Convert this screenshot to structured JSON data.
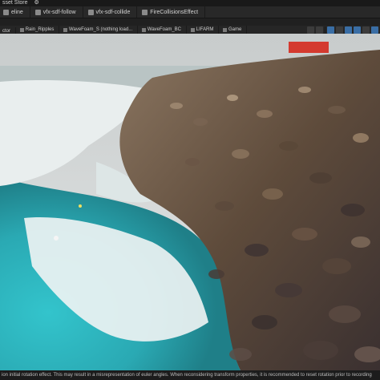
{
  "top_strip": {
    "items": [
      "sset Store",
      "eline",
      "vfx-sdf-follow",
      "vfx-sdf-collide",
      "FireCollisionsEffect"
    ]
  },
  "scene_tabs": [
    "ctor",
    "Rain_Ripples",
    "WaveFoam_S (nothing load...",
    "WaveFoam_BC",
    "LIFARM",
    "Game"
  ],
  "status_bar": {
    "message": "ion initial rotation effect. This may result in a misrepresentation of euler angles. When reconsidering transform properties, it is recommended to reset rotation prior to recording"
  },
  "colors": {
    "toolbar_bg": "#282828",
    "accent": "#3a6ea5",
    "water": "#2fb7c0",
    "foam": "#eaf0f0",
    "rocks": "#5a4a3c"
  }
}
